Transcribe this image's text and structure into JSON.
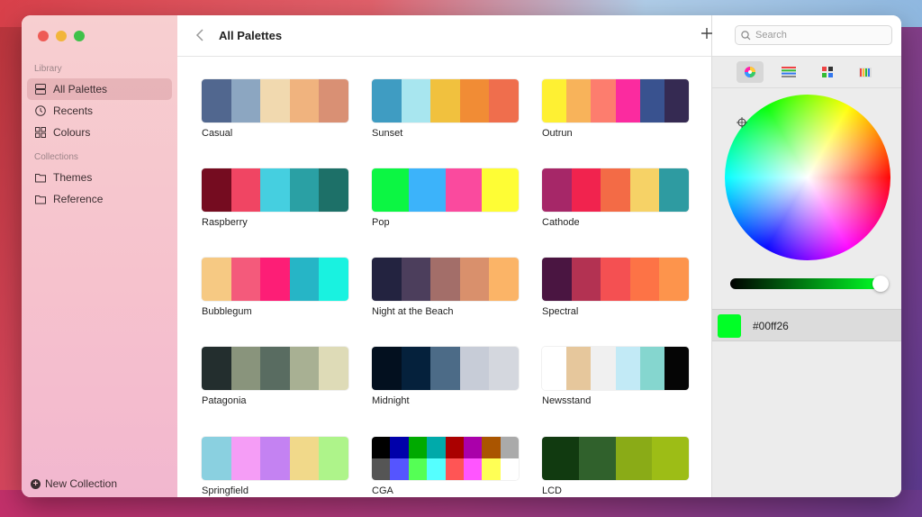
{
  "sidebar": {
    "library_heading": "Library",
    "collections_heading": "Collections",
    "items": [
      {
        "label": "All Palettes",
        "icon": "list-icon"
      },
      {
        "label": "Recents",
        "icon": "clock-icon"
      },
      {
        "label": "Colours",
        "icon": "grid-icon"
      }
    ],
    "collections": [
      {
        "label": "Themes",
        "icon": "folder-icon"
      },
      {
        "label": "Reference",
        "icon": "folder-icon"
      }
    ],
    "new_collection": "New Collection"
  },
  "toolbar": {
    "title": "All Palettes",
    "search_placeholder": "Search"
  },
  "palettes": [
    {
      "name": "Casual",
      "colors": [
        "#51678f",
        "#8ca6c1",
        "#f1d9af",
        "#f0b37e",
        "#d99074"
      ]
    },
    {
      "name": "Sunset",
      "colors": [
        "#3f9cc2",
        "#a8e6ef",
        "#f1c13e",
        "#f18c35",
        "#ef6e4d"
      ]
    },
    {
      "name": "Outrun",
      "colors": [
        "#fef033",
        "#f8b35a",
        "#fd7d6e",
        "#fb2b9f",
        "#39528f",
        "#352a52"
      ]
    },
    {
      "name": "Raspberry",
      "colors": [
        "#750c20",
        "#f04563",
        "#45cfe0",
        "#2aa0a4",
        "#1d7068"
      ]
    },
    {
      "name": "Pop",
      "colors": [
        "#0cf643",
        "#3cb3fa",
        "#fa4a9e",
        "#fefd35"
      ]
    },
    {
      "name": "Cathode",
      "colors": [
        "#a62768",
        "#f1234e",
        "#f36b46",
        "#f6d266",
        "#2e9ba1"
      ]
    },
    {
      "name": "Bubblegum",
      "colors": [
        "#f6c983",
        "#f45a7b",
        "#fd1e76",
        "#26b5c6",
        "#19f2e0"
      ]
    },
    {
      "name": "Night at the Beach",
      "colors": [
        "#232340",
        "#4c3e5c",
        "#a36e69",
        "#d9906c",
        "#fbb467"
      ]
    },
    {
      "name": "Spectral",
      "colors": [
        "#4a1541",
        "#b33252",
        "#f45052",
        "#fd7346",
        "#fd944c"
      ]
    },
    {
      "name": "Patagonia",
      "colors": [
        "#232e2e",
        "#89947c",
        "#596c61",
        "#a8b093",
        "#dedbb7"
      ]
    },
    {
      "name": "Midnight",
      "colors": [
        "#03101f",
        "#05213c",
        "#4c6b87",
        "#c7ccd7",
        "#d4d7de"
      ]
    },
    {
      "name": "Newsstand",
      "colors": [
        "#ffffff",
        "#e6c79c",
        "#f0f0f0",
        "#c2eaf6",
        "#85d6cf",
        "#050505"
      ]
    },
    {
      "name": "Springfield",
      "colors": [
        "#8ad0e0",
        "#f59df6",
        "#c482f2",
        "#f1d98a",
        "#aef48a"
      ]
    },
    {
      "name": "CGA",
      "colors": [
        "#000000",
        "#0000aa",
        "#00aa00",
        "#00aaaa",
        "#aa0000",
        "#aa00aa",
        "#aa5500",
        "#aaaaaa",
        "#555555",
        "#5555ff",
        "#55ff55",
        "#55ffff",
        "#ff5555",
        "#ff55ff",
        "#ffff55",
        "#ffffff"
      ]
    },
    {
      "name": "LCD",
      "colors": [
        "#113a10",
        "#30612c",
        "#8aab17",
        "#9dbd16"
      ]
    }
  ],
  "picker": {
    "modes": [
      "color-wheel-icon",
      "sliders-icon",
      "palette-grid-icon",
      "crayons-icon"
    ],
    "selected_hex": "#00ff26",
    "selected_color": "#00ff26"
  }
}
